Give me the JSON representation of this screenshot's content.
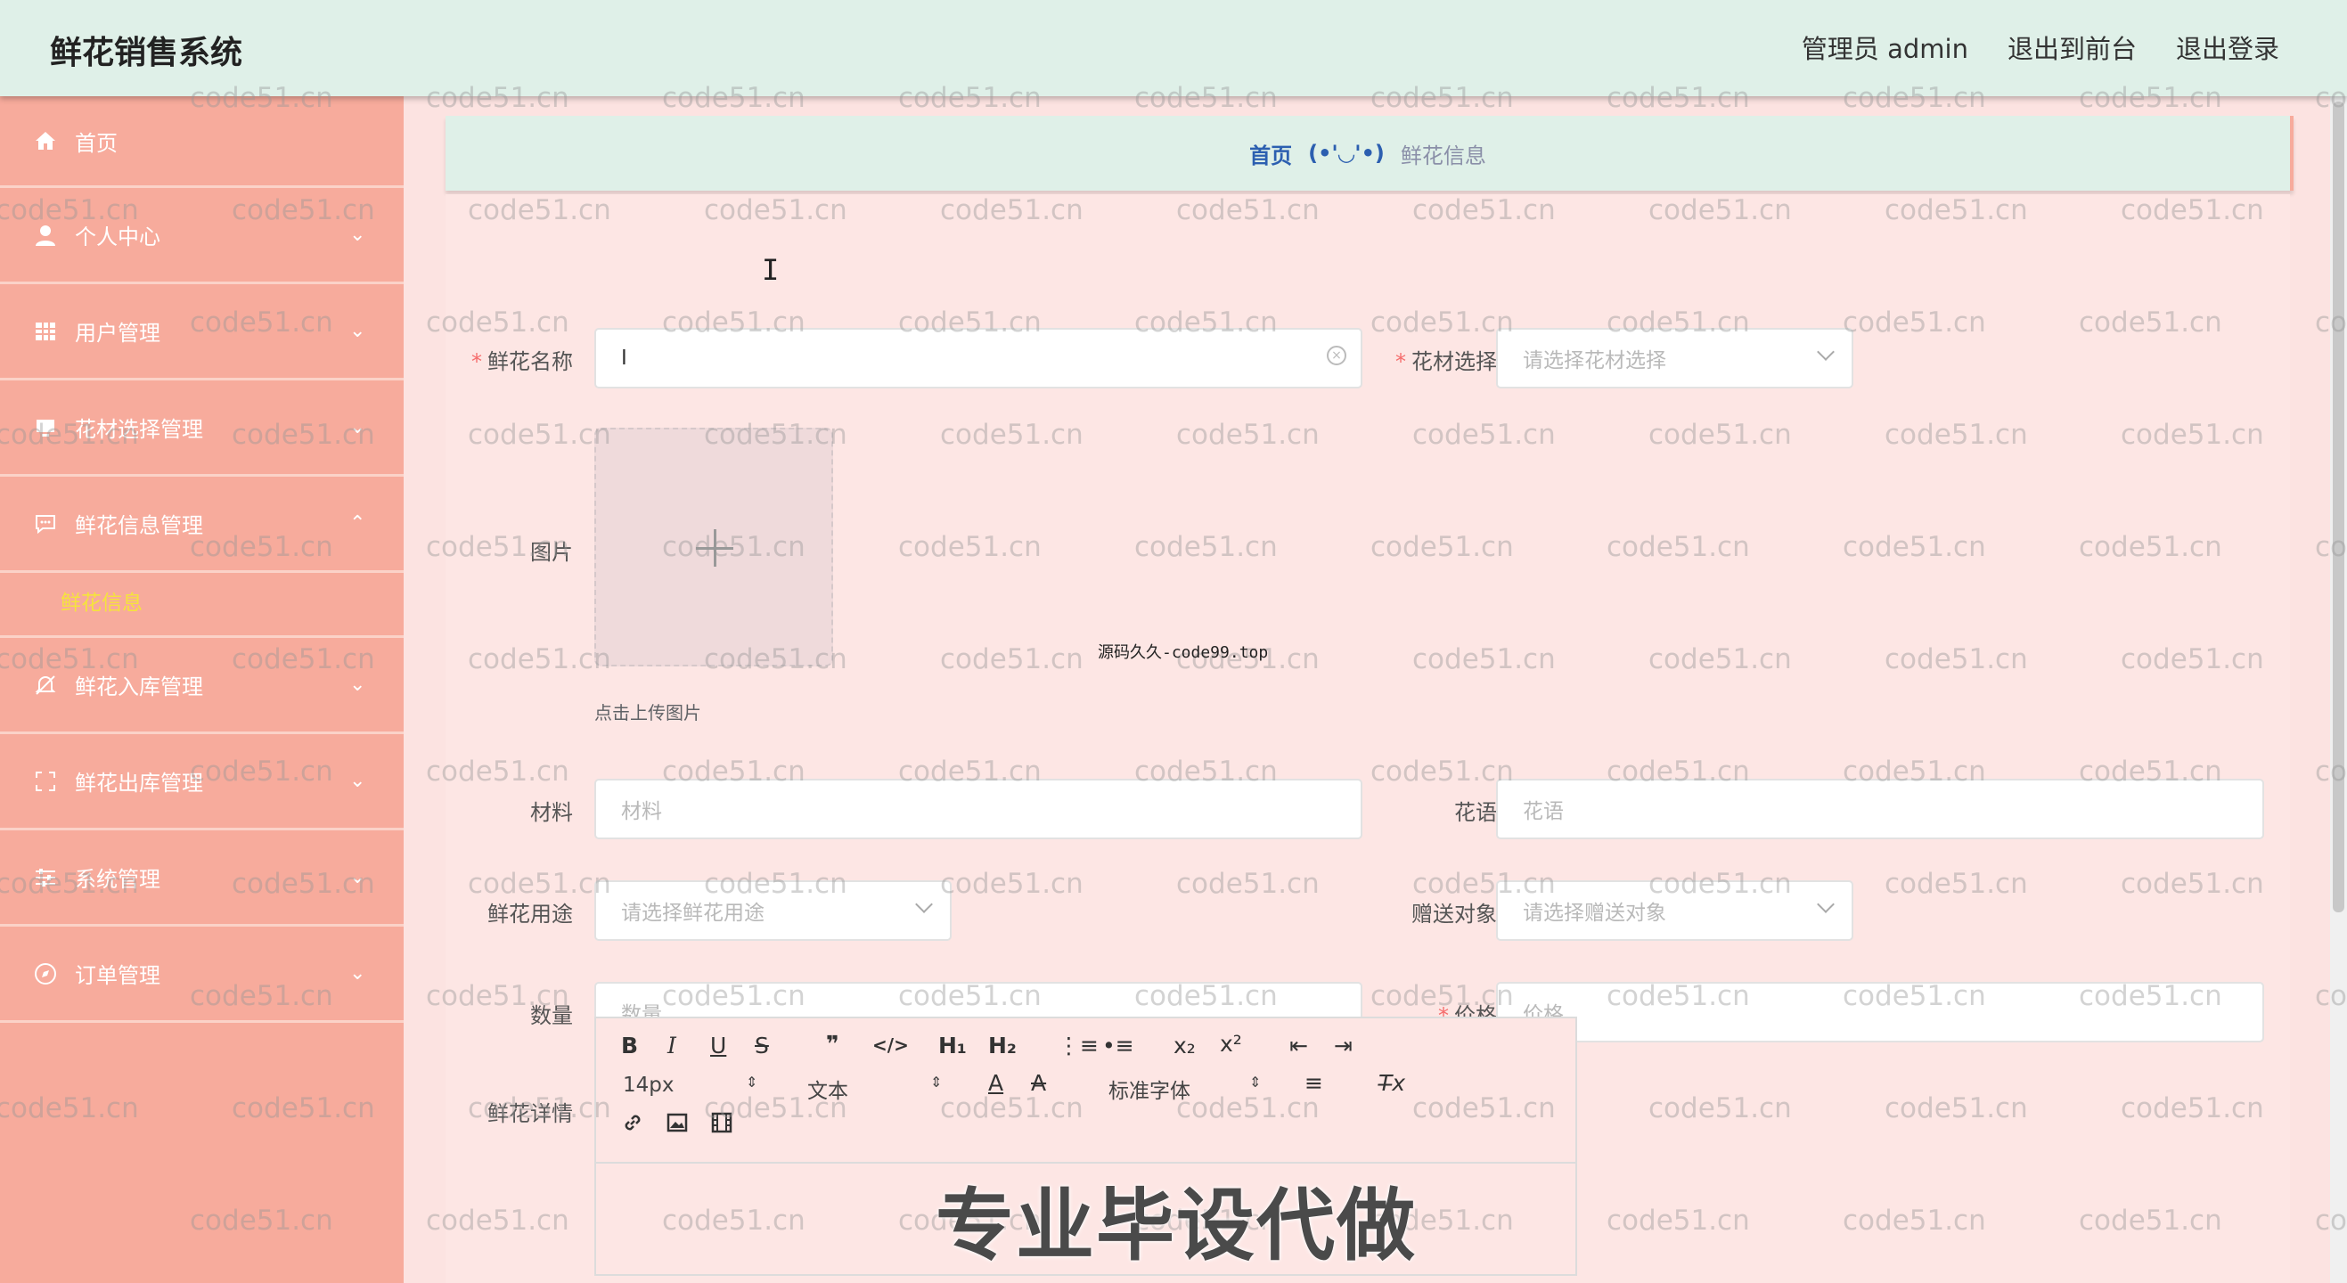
{
  "header": {
    "app_title": "鲜花销售系统",
    "user_label": "管理员 admin",
    "to_frontend": "退出到前台",
    "logout": "退出登录"
  },
  "sidebar": {
    "items": [
      {
        "label": "首页",
        "icon": "home-icon"
      },
      {
        "label": "个人中心",
        "icon": "user-icon"
      },
      {
        "label": "用户管理",
        "icon": "grid-icon"
      },
      {
        "label": "花材选择管理",
        "icon": "monitor-icon"
      },
      {
        "label": "鲜花信息管理",
        "icon": "chat-icon"
      },
      {
        "label": "鲜花入库管理",
        "icon": "bell-off-icon"
      },
      {
        "label": "鲜花出库管理",
        "icon": "fullscreen-icon"
      },
      {
        "label": "系统管理",
        "icon": "sliders-icon"
      },
      {
        "label": "订单管理",
        "icon": "compass-icon"
      }
    ],
    "active_sub": "鲜花信息"
  },
  "breadcrumb": {
    "home": "首页",
    "face": "(•'◡'•)",
    "current": "鲜花信息"
  },
  "form": {
    "name_label": "鲜花名称",
    "name_value": "I",
    "material_select_label": "花材选择",
    "material_select_placeholder": "请选择花材选择",
    "image_label": "图片",
    "upload_hint": "点击上传图片",
    "material_label": "材料",
    "material_placeholder": "材料",
    "flower_language_label": "花语",
    "flower_language_placeholder": "花语",
    "usage_label": "鲜花用途",
    "usage_placeholder": "请选择鲜花用途",
    "recipient_label": "赠送对象",
    "recipient_placeholder": "请选择赠送对象",
    "quantity_label": "数量",
    "quantity_placeholder": "数量",
    "price_label": "价格",
    "price_placeholder": "价格",
    "detail_label": "鲜花详情"
  },
  "editor": {
    "bold": "B",
    "italic": "I",
    "underline": "U",
    "strike": "S",
    "quote": "❞",
    "code": "</>",
    "h1": "H₁",
    "h2": "H₂",
    "ordered_list": "⋮≡",
    "bullet_list": "•≡",
    "subscript": "x₂",
    "superscript": "x²",
    "outdent": "⇤",
    "indent": "⇥",
    "size": "14px",
    "header": "文本",
    "font": "标准字体",
    "align": "≡",
    "clean": "T̶x",
    "link_icon": "link-icon",
    "image_icon": "image-icon",
    "video_icon": "video-icon"
  },
  "watermark_text": "code51.cn",
  "overlays": {
    "small": "源码久久-code99.top",
    "big": "专业毕设代做"
  }
}
